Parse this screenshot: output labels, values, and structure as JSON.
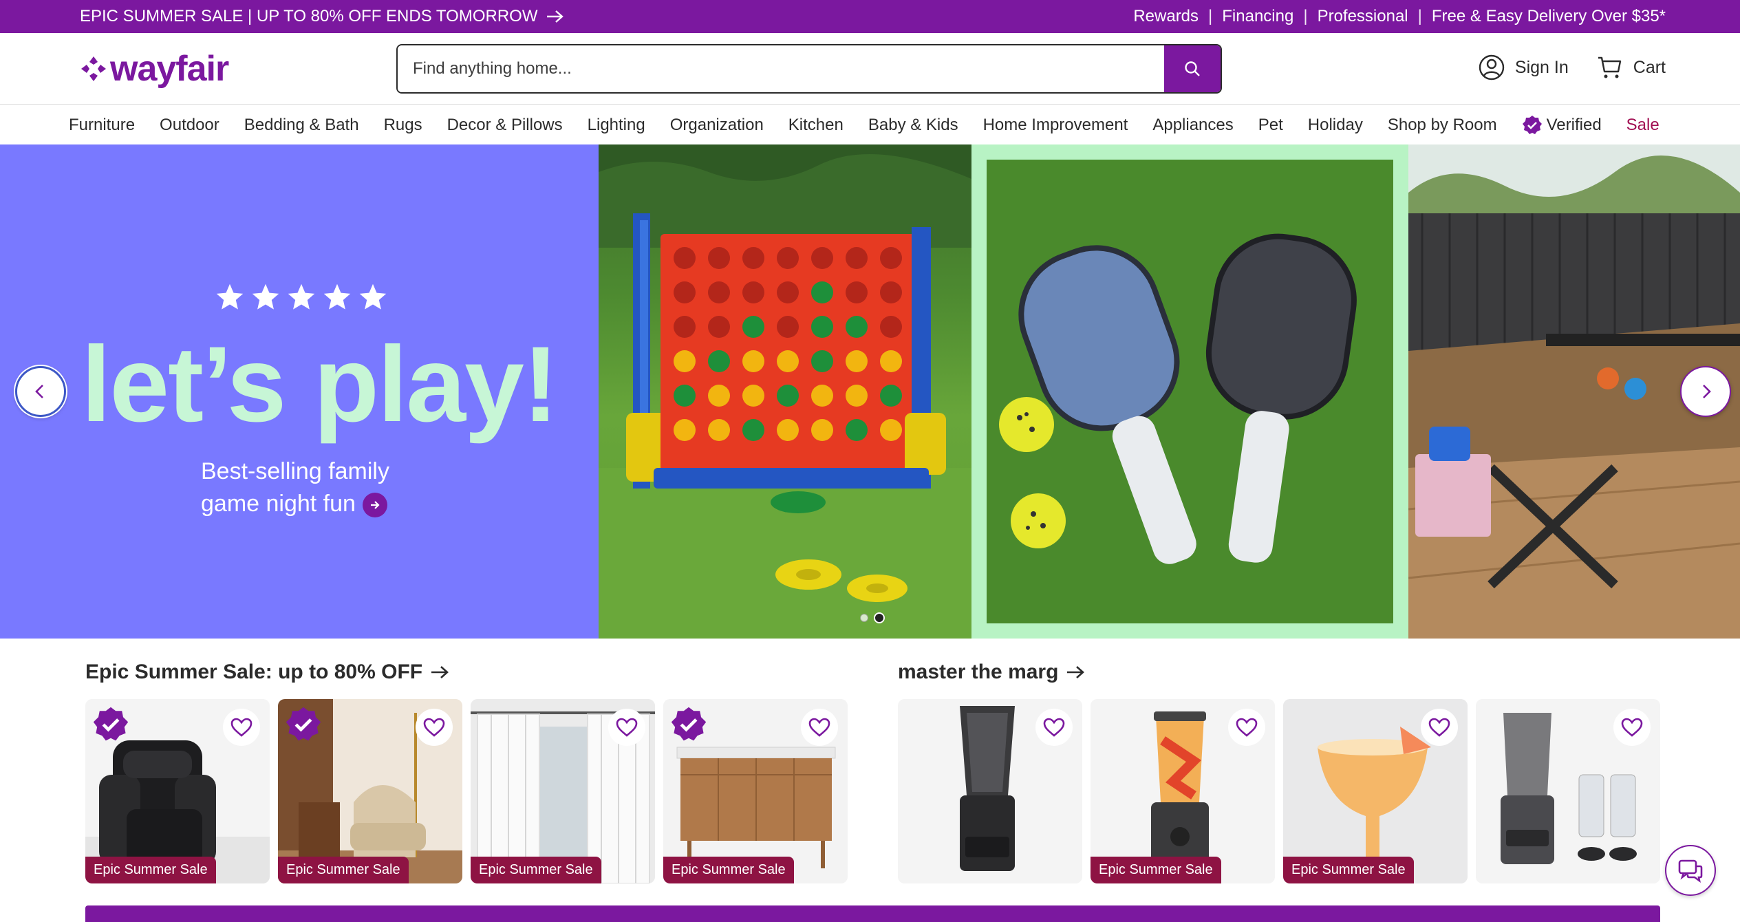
{
  "promo": {
    "sale_text": "EPIC SUMMER SALE | UP TO 80% OFF ENDS TOMORROW",
    "links": [
      "Rewards",
      "Financing",
      "Professional",
      "Free & Easy Delivery Over $35*"
    ]
  },
  "header": {
    "logo_text": "wayfair",
    "search_placeholder": "Find anything home...",
    "sign_in_label": "Sign In",
    "cart_label": "Cart"
  },
  "nav": {
    "items": [
      "Furniture",
      "Outdoor",
      "Bedding & Bath",
      "Rugs",
      "Decor & Pillows",
      "Lighting",
      "Organization",
      "Kitchen",
      "Baby & Kids",
      "Home Improvement",
      "Appliances",
      "Pet",
      "Holiday",
      "Shop by Room"
    ],
    "verified_label": "Verified",
    "sale_label": "Sale"
  },
  "hero": {
    "title": "let’s play!",
    "subtitle_line1": "Best-selling family",
    "subtitle_line2": "game night fun",
    "star_count": 5,
    "slide_count": 2,
    "active_slide": 2
  },
  "sale_section": {
    "title": "Epic Summer Sale: up to 80% OFF",
    "cards": [
      {
        "tag": "Epic Summer Sale",
        "verified": true,
        "image": "recliner-chair"
      },
      {
        "tag": "Epic Summer Sale",
        "verified": true,
        "image": "accent-chair-room"
      },
      {
        "tag": "Epic Summer Sale",
        "verified": false,
        "image": "white-curtains"
      },
      {
        "tag": "Epic Summer Sale",
        "verified": true,
        "image": "wood-vanity"
      }
    ]
  },
  "marg_section": {
    "title": "master the marg",
    "cards": [
      {
        "tag": "",
        "image": "ninja-blender"
      },
      {
        "tag": "Epic Summer Sale",
        "image": "vitamix-blender"
      },
      {
        "tag": "Epic Summer Sale",
        "image": "margarita-glass"
      },
      {
        "tag": "",
        "image": "blender-set"
      }
    ]
  },
  "colors": {
    "brand_purple": "#7b189f",
    "hero_bg": "#7979ff",
    "hero_title": "#c7f6d6",
    "sale_tag": "#8e1343",
    "sale_nav": "#a10e52"
  }
}
